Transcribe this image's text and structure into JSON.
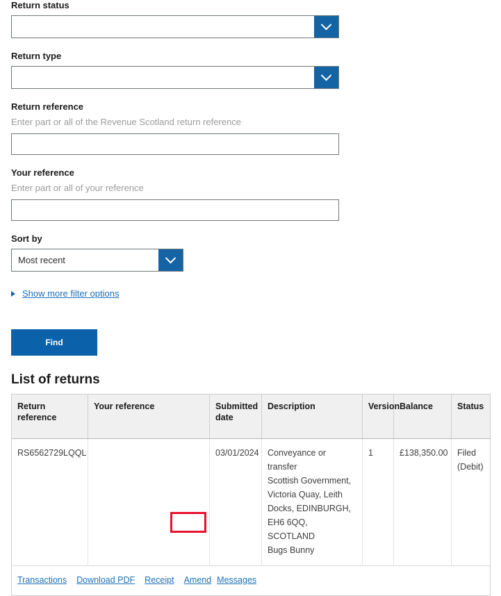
{
  "form": {
    "return_status": {
      "label": "Return status",
      "value": "",
      "icon": "chevron-down-icon"
    },
    "return_type": {
      "label": "Return type",
      "value": "",
      "icon": "chevron-down-icon"
    },
    "return_reference": {
      "label": "Return reference",
      "hint": "Enter part or all of the Revenue Scotland return reference",
      "value": "",
      "placeholder": ""
    },
    "your_reference": {
      "label": "Your reference",
      "hint": "Enter part or all of your reference",
      "value": "",
      "placeholder": ""
    },
    "sort_by": {
      "label": "Sort by",
      "value": "Most recent",
      "icon": "chevron-down-icon"
    },
    "show_more_filters": {
      "label": "Show more filter options",
      "icon": "triangle-right-icon"
    },
    "find_button": "Find"
  },
  "results": {
    "title": "List of returns",
    "columns": [
      "Return reference",
      "Your reference",
      "Submitted date",
      "Description",
      "Version",
      "Balance",
      "Status"
    ],
    "rows": [
      {
        "return_reference": "RS6562729LQQL",
        "your_reference": "",
        "submitted_date": "03/01/2024",
        "description_lines": [
          "Conveyance or transfer",
          "Scottish Government,",
          "Victoria Quay, Leith",
          "Docks, EDINBURGH,",
          "EH6 6QQ, SCOTLAND",
          "Bugs Bunny"
        ],
        "version": "1",
        "balance": "£138,350.00",
        "status": "Filed (Debit)"
      }
    ],
    "actions": [
      "Transactions",
      "Download PDF",
      "Receipt",
      "Amend",
      "Messages"
    ],
    "highlighted_action": "Amend"
  },
  "colors": {
    "accent_blue": "#1464a5",
    "button_blue": "#0b62ab",
    "link_blue": "#1d70b8",
    "annotation_red": "#e8112d",
    "header_grey": "#f0f0f0"
  }
}
